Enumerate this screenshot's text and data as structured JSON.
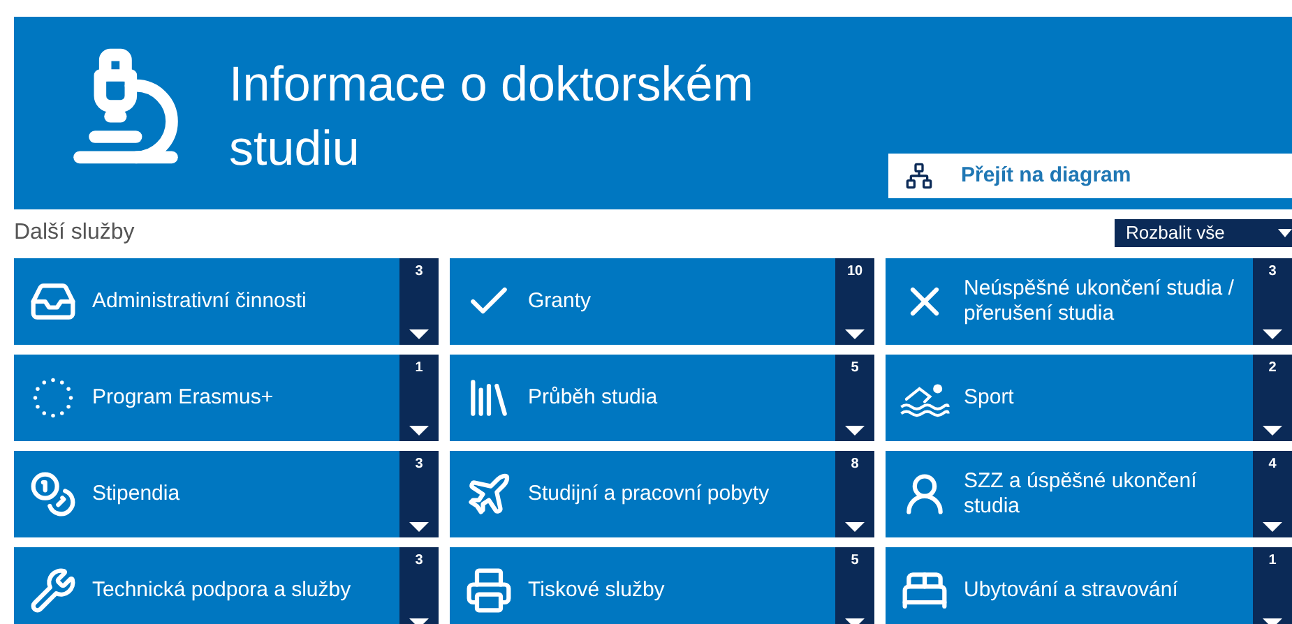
{
  "header": {
    "title": "Informace o doktorském studiu",
    "diagram_link": "Přejít na diagram"
  },
  "section": {
    "title": "Další služby",
    "expand_all": "Rozbalit vše"
  },
  "tiles": [
    {
      "label": "Administrativní činnosti",
      "count": "3",
      "expanded": false
    },
    {
      "label": "Granty",
      "count": "10",
      "expanded": false
    },
    {
      "label": "Neúspěšné ukončení studia / přerušení studia",
      "count": "3",
      "expanded": false
    },
    {
      "label": "Program Erasmus+",
      "count": "1",
      "expanded": false
    },
    {
      "label": "Průběh studia",
      "count": "5",
      "expanded": false
    },
    {
      "label": "Sport",
      "count": "2",
      "expanded": false
    },
    {
      "label": "Stipendia",
      "count": "3",
      "expanded": false
    },
    {
      "label": "Studijní a pracovní pobyty",
      "count": "8",
      "expanded": false
    },
    {
      "label": "SZZ a úspěšné ukončení studia",
      "count": "4",
      "expanded": false
    },
    {
      "label": "Technická podpora a služby",
      "count": "3",
      "expanded": false
    },
    {
      "label": "Tiskové služby",
      "count": "5",
      "expanded": false
    },
    {
      "label": "Ubytování a stravování",
      "count": "1",
      "expanded": false
    }
  ]
}
